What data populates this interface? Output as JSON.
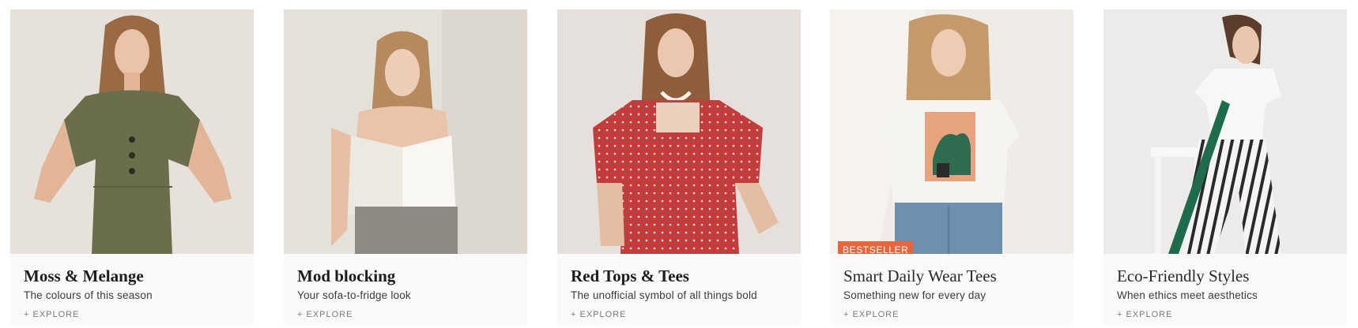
{
  "cards": [
    {
      "title": "Moss & Melange",
      "subtitle": "The colours of this season",
      "cta": "+ EXPLORE",
      "image_desc_icon": "model-olive-dress-photo",
      "bg": "#e7e1dc",
      "garment": "#6b6e4b"
    },
    {
      "title": "Mod blocking",
      "subtitle": "Your sofa-to-fridge look",
      "cta": "+ EXPLORE",
      "image_desc_icon": "model-colorblock-cami-photo",
      "bg": "#e4e1d8",
      "garment": "#eeece4"
    },
    {
      "title": "Red Tops & Tees",
      "subtitle": "The unofficial symbol of all things bold",
      "cta": "+ EXPLORE",
      "image_desc_icon": "model-red-floral-top-photo",
      "bg": "#e6e0dc",
      "garment": "#c63a3c"
    },
    {
      "title": "Smart Daily Wear Tees",
      "subtitle": "Something new for every day",
      "cta": "+ EXPLORE",
      "badge": "BESTSELLER",
      "image_desc_icon": "model-graphic-tee-photo",
      "bg": "#efebe6",
      "garment": "#f6f4f1"
    },
    {
      "title": "Eco-Friendly Styles",
      "subtitle": "When ethics meet aesthetics",
      "cta": "+ EXPLORE",
      "image_desc_icon": "model-white-tee-striped-pants-photo",
      "bg": "#ecebea",
      "garment": "#f7f7f7"
    }
  ],
  "colors": {
    "badge": "#e8643c",
    "card_bg": "#fafafa",
    "title": "#1c1c1c",
    "subtitle": "#3a3a3a",
    "cta": "#7a7a7a"
  }
}
